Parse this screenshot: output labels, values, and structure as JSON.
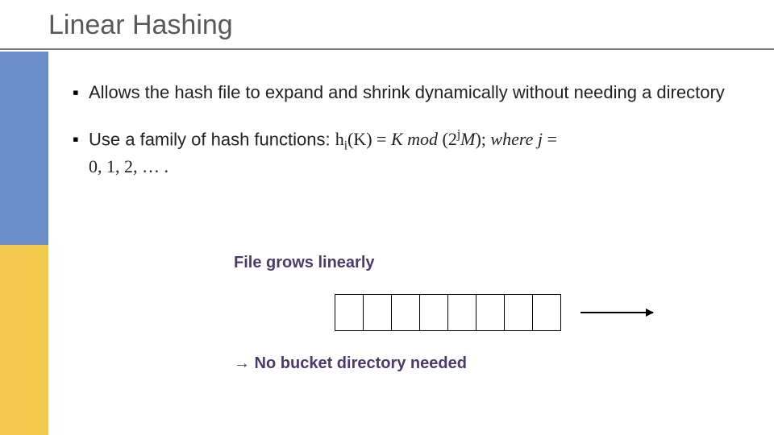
{
  "title": "Linear Hashing",
  "bullets": {
    "b1": "Allows the hash file to expand and shrink dynamically without needing a directory",
    "b2_prefix": "Use a family of hash functions: ",
    "formula": {
      "fn": "h",
      "sub": "i",
      "arg": "(K)",
      "eq": " = ",
      "K": "K",
      "mod": " mod ",
      "lpar": "(",
      "two": "2",
      "exp": "j",
      "M": "M",
      "rpar": ")",
      "semi": "; ",
      "where": "where ",
      "j": "j",
      "eq2": " =",
      "tail": "0, 1, 2, … ."
    }
  },
  "caption1": "File grows linearly",
  "caption2_arrow": "→",
  "caption2_text": " No bucket directory needed",
  "buckets": {
    "count": 8
  }
}
